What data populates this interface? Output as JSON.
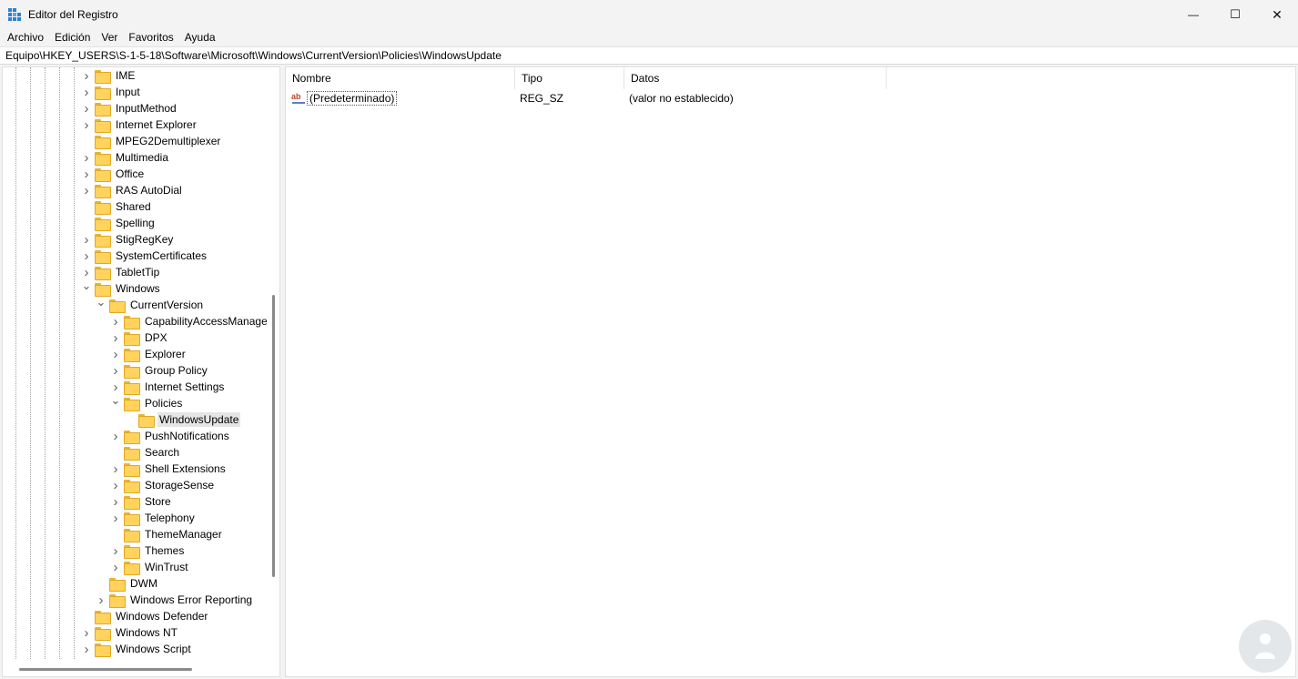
{
  "window": {
    "title": "Editor del Registro",
    "controls": {
      "minimize": "—",
      "maximize": "☐",
      "close": "✕"
    }
  },
  "menu": [
    "Archivo",
    "Edición",
    "Ver",
    "Favoritos",
    "Ayuda"
  ],
  "address": "Equipo\\HKEY_USERS\\S-1-5-18\\Software\\Microsoft\\Windows\\CurrentVersion\\Policies\\WindowsUpdate",
  "tree": [
    {
      "label": "IME",
      "depth": 0,
      "state": "collapsed"
    },
    {
      "label": "Input",
      "depth": 0,
      "state": "collapsed"
    },
    {
      "label": "InputMethod",
      "depth": 0,
      "state": "collapsed"
    },
    {
      "label": "Internet Explorer",
      "depth": 0,
      "state": "collapsed"
    },
    {
      "label": "MPEG2Demultiplexer",
      "depth": 0,
      "state": "leaf"
    },
    {
      "label": "Multimedia",
      "depth": 0,
      "state": "collapsed"
    },
    {
      "label": "Office",
      "depth": 0,
      "state": "collapsed"
    },
    {
      "label": "RAS AutoDial",
      "depth": 0,
      "state": "collapsed"
    },
    {
      "label": "Shared",
      "depth": 0,
      "state": "leaf"
    },
    {
      "label": "Spelling",
      "depth": 0,
      "state": "leaf"
    },
    {
      "label": "StigRegKey",
      "depth": 0,
      "state": "collapsed"
    },
    {
      "label": "SystemCertificates",
      "depth": 0,
      "state": "collapsed"
    },
    {
      "label": "TabletTip",
      "depth": 0,
      "state": "collapsed"
    },
    {
      "label": "Windows",
      "depth": 0,
      "state": "expanded"
    },
    {
      "label": "CurrentVersion",
      "depth": 1,
      "state": "expanded"
    },
    {
      "label": "CapabilityAccessManager",
      "depth": 2,
      "state": "collapsed"
    },
    {
      "label": "DPX",
      "depth": 2,
      "state": "collapsed"
    },
    {
      "label": "Explorer",
      "depth": 2,
      "state": "collapsed"
    },
    {
      "label": "Group Policy",
      "depth": 2,
      "state": "collapsed"
    },
    {
      "label": "Internet Settings",
      "depth": 2,
      "state": "collapsed"
    },
    {
      "label": "Policies",
      "depth": 2,
      "state": "expanded"
    },
    {
      "label": "WindowsUpdate",
      "depth": 3,
      "state": "leaf",
      "selected": true
    },
    {
      "label": "PushNotifications",
      "depth": 2,
      "state": "collapsed"
    },
    {
      "label": "Search",
      "depth": 2,
      "state": "leaf"
    },
    {
      "label": "Shell Extensions",
      "depth": 2,
      "state": "collapsed"
    },
    {
      "label": "StorageSense",
      "depth": 2,
      "state": "collapsed"
    },
    {
      "label": "Store",
      "depth": 2,
      "state": "collapsed"
    },
    {
      "label": "Telephony",
      "depth": 2,
      "state": "collapsed"
    },
    {
      "label": "ThemeManager",
      "depth": 2,
      "state": "leaf"
    },
    {
      "label": "Themes",
      "depth": 2,
      "state": "collapsed"
    },
    {
      "label": "WinTrust",
      "depth": 2,
      "state": "collapsed"
    },
    {
      "label": "DWM",
      "depth": 1,
      "state": "leaf"
    },
    {
      "label": "Windows Error Reporting",
      "depth": 1,
      "state": "collapsed"
    },
    {
      "label": "Windows Defender",
      "depth": 0,
      "state": "leaf"
    },
    {
      "label": "Windows NT",
      "depth": 0,
      "state": "collapsed"
    },
    {
      "label": "Windows Script",
      "depth": 0,
      "state": "collapsed"
    }
  ],
  "list": {
    "columns": [
      "Nombre",
      "Tipo",
      "Datos"
    ],
    "rows": [
      {
        "name": "(Predeterminado)",
        "type": "REG_SZ",
        "data": "(valor no establecido)",
        "icon": "string-value-icon"
      }
    ]
  },
  "colors": {
    "folder": "#ffd35c",
    "selection": "#e5e5e5",
    "background": "#f3f3f3"
  }
}
